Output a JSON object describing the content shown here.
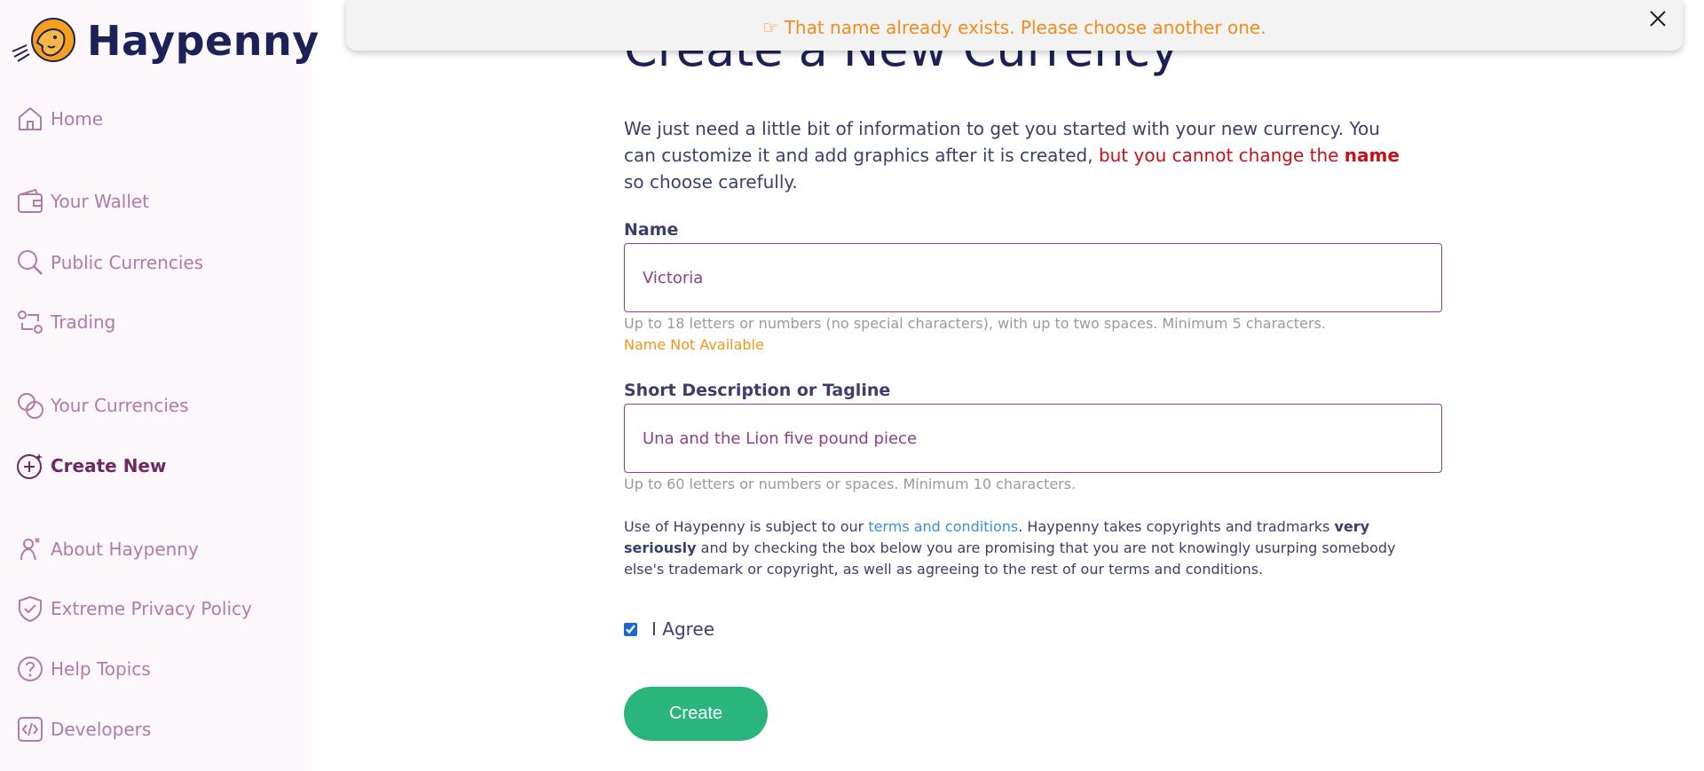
{
  "app": {
    "name": "Haypenny",
    "brand_color": "#1c2257",
    "accent_color": "#2ab57d"
  },
  "toast": {
    "icon": "pointing-hand",
    "message": "☞ That name already exists. Please choose another one.",
    "close_icon": "close-icon"
  },
  "sidebar": {
    "items": [
      {
        "label": "Home",
        "icon": "home-icon"
      },
      {
        "label": "Your Wallet",
        "icon": "wallet-icon"
      },
      {
        "label": "Public Currencies",
        "icon": "search-icon"
      },
      {
        "label": "Trading",
        "icon": "trading-icon"
      },
      {
        "label": "Your Currencies",
        "icon": "coins-icon"
      },
      {
        "label": "Create New",
        "icon": "plus-sparkle-icon",
        "active": true
      },
      {
        "label": "About Haypenny",
        "icon": "about-icon"
      },
      {
        "label": "Extreme Privacy Policy",
        "icon": "shield-check-icon"
      },
      {
        "label": "Help Topics",
        "icon": "help-icon"
      },
      {
        "label": "Developers",
        "icon": "code-icon"
      }
    ]
  },
  "page": {
    "title": "Create a New Currency",
    "intro_part1": "We just need a little bit of information to get you started with your new currency. You can customize it and add graphics after it is created, ",
    "intro_warn": "but you cannot change the ",
    "intro_warn_bold": "name",
    "intro_part2": " so choose carefully."
  },
  "form": {
    "name": {
      "label": "Name",
      "value": "Victoria",
      "hint": "Up to 18 letters or numbers (no special characters), with up to two spaces. Minimum 5 characters.",
      "error": "Name Not Available"
    },
    "tagline": {
      "label": "Short Description or Tagline",
      "value": "Una and the Lion five pound piece",
      "hint": "Up to 60 letters or numbers or spaces. Minimum 10 characters."
    },
    "terms": {
      "part1": "Use of Haypenny is subject to our ",
      "link": "terms and conditions",
      "part2": ". Haypenny takes copyrights and tradmarks ",
      "bold": "very seriously",
      "part3": " and by checking the box below you are promising that you are not knowingly usurping somebody else's trademark or copyright, as well as agreeing to the rest of our terms and conditions."
    },
    "agree": {
      "label": "I Agree",
      "checked": true
    },
    "submit_label": "Create"
  }
}
